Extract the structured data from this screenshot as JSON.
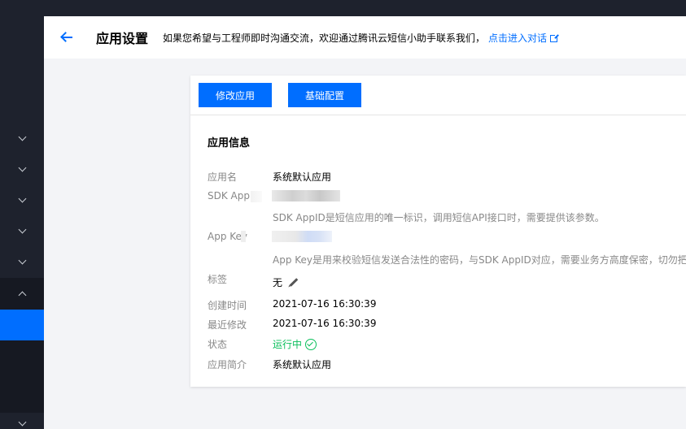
{
  "header": {
    "title": "应用设置",
    "tip": "如果您希望与工程师即时沟通交流，欢迎通过腾讯云短信小助手联系我们，",
    "tip_link": "点击进入对话"
  },
  "toolbar": {
    "modify_label": "修改应用",
    "basic_config_label": "基础配置"
  },
  "app_info": {
    "section_title": "应用信息",
    "name_label": "应用名",
    "name_value": "系统默认应用",
    "sdk_label": "SDK App",
    "sdk_hint": "SDK AppID是短信应用的唯一标识，调用短信API接口时，需要提供该参数。",
    "key_label": "App Key",
    "key_hint": "App Key是用来校验短信发送合法性的密码，与SDK AppID对应，需要业务方高度保密，切勿把密",
    "tag_label": "标签",
    "tag_value": "无",
    "created_label": "创建时间",
    "created_value": "2021-07-16 16:30:39",
    "modified_label": "最近修改",
    "modified_value": "2021-07-16 16:30:39",
    "status_label": "状态",
    "status_value": "运行中",
    "desc_label": "应用简介",
    "desc_value": "系统默认应用"
  },
  "colors": {
    "primary": "#006eff",
    "success": "#0abf5b",
    "sidebar": "#1e222d"
  },
  "icons": [
    "back-arrow-icon",
    "external-link-icon",
    "edit-pencil-icon",
    "check-circle-icon",
    "chevron-down-icon",
    "chevron-up-icon"
  ]
}
